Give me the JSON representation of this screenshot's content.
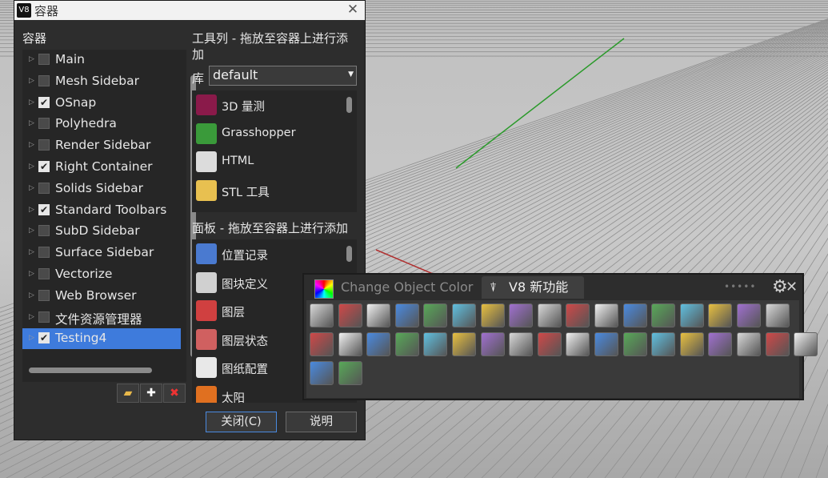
{
  "dialog": {
    "title": "容器",
    "close_glyph": "✕",
    "app_icon": "V8"
  },
  "containers": {
    "label": "容器",
    "items": [
      {
        "label": "Main",
        "checked": false
      },
      {
        "label": "Mesh Sidebar",
        "checked": false
      },
      {
        "label": "OSnap",
        "checked": true
      },
      {
        "label": "Polyhedra",
        "checked": false
      },
      {
        "label": "Render Sidebar",
        "checked": false
      },
      {
        "label": "Right Container",
        "checked": true
      },
      {
        "label": "Solids Sidebar",
        "checked": false
      },
      {
        "label": "Standard Toolbars",
        "checked": true
      },
      {
        "label": "SubD Sidebar",
        "checked": false
      },
      {
        "label": "Surface Sidebar",
        "checked": false
      },
      {
        "label": "Vectorize",
        "checked": false
      },
      {
        "label": "Web Browser",
        "checked": false
      },
      {
        "label": "文件资源管理器",
        "checked": false
      },
      {
        "label": "Testing4",
        "checked": true,
        "selected": true
      }
    ],
    "buttons": {
      "open": "folder-open-icon",
      "add": "plus-icon",
      "delete": "delete-icon"
    }
  },
  "toolbars": {
    "header_line1": "工具列 - 拖放至容器上进行添",
    "header_line2": "加",
    "library_label": "库",
    "library_value": "default",
    "items": [
      {
        "label": "3D 量测",
        "icon": "measure-3d-icon"
      },
      {
        "label": "Grasshopper",
        "icon": "grasshopper-icon"
      },
      {
        "label": "HTML",
        "icon": "html-icon"
      },
      {
        "label": "STL 工具",
        "icon": "folder-icon"
      }
    ]
  },
  "panels": {
    "header": "面板 - 拖放至容器上进行添加",
    "items": [
      {
        "label": "位置记录",
        "icon": "named-position-icon"
      },
      {
        "label": "图块定义",
        "icon": "block-definition-icon"
      },
      {
        "label": "图层",
        "icon": "layers-icon"
      },
      {
        "label": "图层状态",
        "icon": "layer-state-icon"
      },
      {
        "label": "图纸配置",
        "icon": "layout-icon"
      },
      {
        "label": "太阳",
        "icon": "sun-icon"
      }
    ]
  },
  "footer": {
    "close_label": "关闭(C)",
    "help_label": "说明"
  },
  "floating_toolbar": {
    "tab1": "Change Object Color",
    "tab2": "V8 新功能",
    "gear": "⚙",
    "close": "✕",
    "grip": "•••••",
    "icons": [
      "mesh-points-icon",
      "view-capture-icon",
      "render-sphere-icon",
      "boolean-icon",
      "code-script-icon",
      "box-grid-icon",
      "display-icon",
      "paint-brush-icon",
      "head-icon",
      "transform-box-icon",
      "point-cloud-icon",
      "rounded-square-icon",
      "selection-rect-icon",
      "scatter-icon",
      "walk-icon",
      "grid-surface-icon",
      "cube-v-icon",
      "dimension-icon",
      "move-icon",
      "curve-arrow-icon",
      "surface-fold-icon",
      "flow-surface-icon",
      "bend-icon",
      "cube-pair-icon",
      "cube-select-icon",
      "frame-icon",
      "refresh-icon",
      "add-solid-icon",
      "color-grid-icon",
      "extrude-blue-icon",
      "checker-icon",
      "star-icon",
      "pen-surface-icon",
      "clipboard-icon",
      "folder-yellow-icon",
      "windows-icon",
      "house-icon"
    ]
  },
  "colors": {
    "accent": "#3e7bdc",
    "bg": "#2d2d2d",
    "panel": "#262626"
  }
}
